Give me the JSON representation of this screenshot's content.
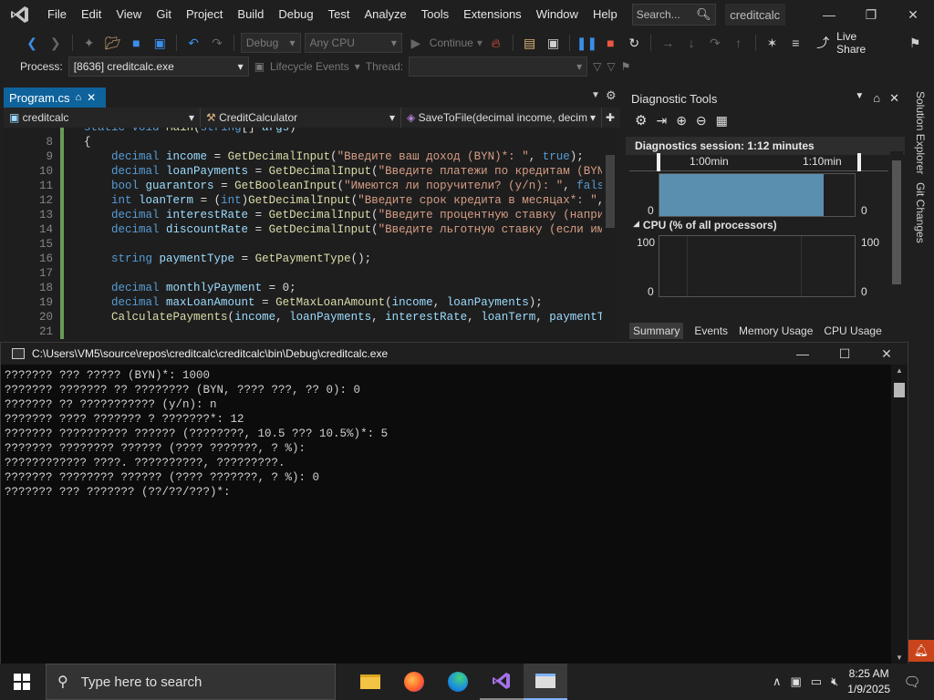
{
  "menu": {
    "items": [
      "File",
      "Edit",
      "View",
      "Git",
      "Project",
      "Build",
      "Debug",
      "Test",
      "Analyze",
      "Tools",
      "Extensions",
      "Window",
      "Help"
    ],
    "search_placeholder": "Search...",
    "solution_name": "creditcalc"
  },
  "toolbar": {
    "config": "Debug",
    "platform": "Any CPU",
    "continue_label": "Continue",
    "live_share": "Live Share"
  },
  "toolbar2": {
    "process_label": "Process:",
    "process_value": "[8636] creditcalc.exe",
    "lifecycle_label": "Lifecycle Events",
    "thread_label": "Thread:"
  },
  "editor": {
    "tab_label": "Program.cs",
    "nav_project": "creditcalc",
    "nav_class": "CreditCalculator",
    "nav_member": "SaveToFile(decimal income, decim",
    "lines": [
      {
        "n": "",
        "code": "static void Main(string[] args)"
      },
      {
        "n": "8",
        "code": "{"
      },
      {
        "n": "9",
        "code": "    decimal income = GetDecimalInput(\"Введите ваш доход (BYN)*: \", true);"
      },
      {
        "n": "10",
        "code": "    decimal loanPayments = GetDecimalInput(\"Введите платежи по кредитам (BYN"
      },
      {
        "n": "11",
        "code": "    bool guarantors = GetBooleanInput(\"Имеются ли поручители? (y/n): \", false"
      },
      {
        "n": "12",
        "code": "    int loanTerm = (int)GetDecimalInput(\"Введите срок кредита в месяцах*: \","
      },
      {
        "n": "13",
        "code": "    decimal interestRate = GetDecimalInput(\"Введите процентную ставку (наприм"
      },
      {
        "n": "14",
        "code": "    decimal discountRate = GetDecimalInput(\"Введите льготную ставку (если име"
      },
      {
        "n": "15",
        "code": ""
      },
      {
        "n": "16",
        "code": "    string paymentType = GetPaymentType();"
      },
      {
        "n": "17",
        "code": ""
      },
      {
        "n": "18",
        "code": "    decimal monthlyPayment = 0;"
      },
      {
        "n": "19",
        "code": "    decimal maxLoanAmount = GetMaxLoanAmount(income, loanPayments);"
      },
      {
        "n": "20",
        "code": "    CalculatePayments(income, loanPayments, interestRate, loanTerm, paymentTy"
      },
      {
        "n": "21",
        "code": ""
      }
    ]
  },
  "diagnostics": {
    "title": "Diagnostic Tools",
    "session": "Diagnostics session: 1:12 minutes",
    "time_labels": [
      "1:00min",
      "1:10min"
    ],
    "events_zero_left": "0",
    "events_zero_right": "0",
    "cpu_label": "CPU (% of all processors)",
    "cpu_max_left": "100",
    "cpu_max_right": "100",
    "cpu_min_left": "0",
    "cpu_min_right": "0",
    "tabs": [
      "Summary",
      "Events",
      "Memory Usage",
      "CPU Usage"
    ]
  },
  "side_panels": [
    "Solution Explorer",
    "Git Changes"
  ],
  "console": {
    "title": "C:\\Users\\VM5\\source\\repos\\creditcalc\\creditcalc\\bin\\Debug\\creditcalc.exe",
    "lines": [
      "??????? ??? ????? (BYN)*: 1000",
      "??????? ??????? ?? ???????? (BYN, ???? ???, ?? 0): 0",
      "??????? ?? ??????????? (y/n): n",
      "??????? ???? ??????? ? ???????*: 12",
      "??????? ?????????? ?????? (????????, 10.5 ??? 10.5%)*: 5",
      "??????? ???????? ?????? (???? ???????, ? %):",
      "???????????? ????. ??????????, ?????????.",
      "??????? ???????? ?????? (???? ???????, ? %): 0",
      "??????? ??? ??????? (??/??/???)*:"
    ]
  },
  "taskbar": {
    "search_placeholder": "Type here to search",
    "time": "8:25 AM",
    "date": "1/9/2025"
  },
  "colors": {
    "accent": "#0e639c",
    "chart_fill": "#5b8fb0"
  }
}
